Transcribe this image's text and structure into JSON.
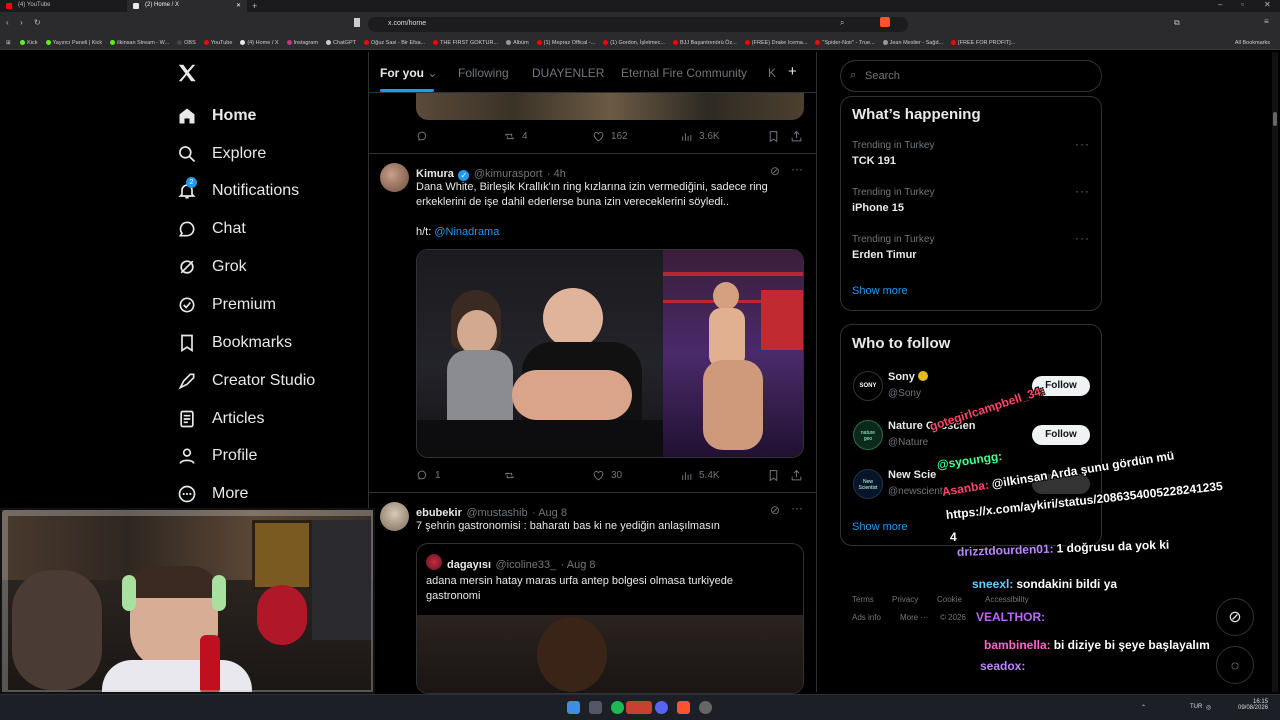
{
  "browser": {
    "tabs": [
      {
        "label": "(4) YouTube",
        "color": "#ff0000"
      },
      {
        "label": "(2) Home / X",
        "color": "#e7e9ea"
      }
    ],
    "url": "x.com/home",
    "bookmarks": [
      {
        "label": "Kick",
        "color": "#53fc18"
      },
      {
        "label": "Yayıncı Paneli | Kick",
        "color": "#53fc18"
      },
      {
        "label": "ilkinsan Stream - W...",
        "color": "#53fc18"
      },
      {
        "label": "OBS",
        "color": "#444444"
      },
      {
        "label": "YouTube",
        "color": "#ff0000"
      },
      {
        "label": "(4) Home / X",
        "color": "#e7e9ea"
      },
      {
        "label": "Instagram",
        "color": "#c13584"
      },
      {
        "label": "ChatGPT",
        "color": "#cccccc"
      },
      {
        "label": "Oğuz Sasi - Bir Efsa...",
        "color": "#ff0000"
      },
      {
        "label": "THE FIRST GOKTUR...",
        "color": "#ff0000"
      },
      {
        "label": "Albüm",
        "color": "#999999"
      },
      {
        "label": "(1) Mepraz Offical -...",
        "color": "#ff0000"
      },
      {
        "label": "(1) Gordon, İşletmec...",
        "color": "#ff0000"
      },
      {
        "label": "BJJ Başantrenörü Öz...",
        "color": "#ff0000"
      },
      {
        "label": "(FREE) Drake Icema...",
        "color": "#ff0000"
      },
      {
        "label": "\"Spider-Noir\" - True...",
        "color": "#ff0000"
      },
      {
        "label": "Jean Meslier - Sağd...",
        "color": "#999999"
      },
      {
        "label": "[FREE FOR PROFIT]...",
        "color": "#ff0000"
      }
    ],
    "all_bookmarks": "All Bookmarks"
  },
  "nav": {
    "items": [
      {
        "label": "Home",
        "icon": "home-icon"
      },
      {
        "label": "Explore",
        "icon": "search-icon"
      },
      {
        "label": "Notifications",
        "icon": "bell-icon",
        "badge": "2"
      },
      {
        "label": "Chat",
        "icon": "chat-icon"
      },
      {
        "label": "Grok",
        "icon": "grok-icon"
      },
      {
        "label": "Premium",
        "icon": "premium-icon"
      },
      {
        "label": "Bookmarks",
        "icon": "bookmark-icon"
      },
      {
        "label": "Creator Studio",
        "icon": "rocket-icon"
      },
      {
        "label": "Articles",
        "icon": "article-icon"
      },
      {
        "label": "Profile",
        "icon": "profile-icon"
      },
      {
        "label": "More",
        "icon": "more-icon"
      }
    ]
  },
  "feed": {
    "tabs": [
      "For you",
      "Following",
      "DUAYENLER",
      "Eternal Fire Community",
      "K"
    ],
    "prev_post": {
      "replies": "",
      "reposts": "4",
      "likes": "162",
      "views": "3.6K"
    },
    "post1": {
      "name": "Kimura",
      "handle": "@kimurasport",
      "time": "· 4h",
      "text_line1": "Dana White, Birleşik Krallık'ın ring kızlarına izin vermediğini, sadece ring",
      "text_line2": "erkeklerini de  işe dahil ederlerse buna izin vereceklerini söyledi..",
      "ht_label": "h/t: ",
      "ht_mention": "@Ninadrama",
      "replies": "1",
      "reposts": "",
      "likes": "30",
      "views": "5.4K"
    },
    "post2": {
      "name": "ebubekir",
      "handle": "@mustashib",
      "time": "· Aug 8",
      "text": "7 şehrin gastronomisi : baharatı bas ki ne yediğin anlaşılmasın",
      "quote": {
        "name": "dagayısı",
        "handle": "@icoline33_",
        "time": "· Aug 8",
        "text_line1": "adana mersin hatay maras urfa antep bolgesi olmasa turkiyede",
        "text_line2": "gastronomi"
      }
    }
  },
  "sidebar": {
    "search_placeholder": "Search",
    "happening_title": "What’s happening",
    "trends": [
      {
        "sub": "Trending in Turkey",
        "name": "TCK 191"
      },
      {
        "sub": "Trending in Turkey",
        "name": "iPhone 15"
      },
      {
        "sub": "Trending in Turkey",
        "name": "Erden Timur"
      }
    ],
    "show_more": "Show more",
    "who_title": "Who to follow",
    "follow": [
      {
        "name": "Sony",
        "handle": "@Sony",
        "button": "Follow"
      },
      {
        "name": "Nature Geoscien",
        "handle": "@Nature",
        "button": "Follow"
      },
      {
        "name": "New Scie",
        "handle": "@newscientist",
        "button": ""
      }
    ],
    "footer": [
      "Terms",
      "Privacy",
      "Cookie",
      "Accessibility",
      "Ads info",
      "More ···",
      "© 2026"
    ]
  },
  "chat_overlay": [
    {
      "user": "gotegirlcampbell_34:",
      "msg": "",
      "color": "#ff4466"
    },
    {
      "user": "@syoungg:",
      "msg": "",
      "color": "#44ff88"
    },
    {
      "user": "Asanba:",
      "msg": "@ilkinsan Arda şunu gördün mü",
      "color": "#ff4466"
    },
    {
      "user": "",
      "msg": "https://x.com/aykiri/status/2086354005228241235",
      "color": "#ffffff"
    },
    {
      "user": "",
      "msg": "4",
      "color": "#ffffff"
    },
    {
      "user": "drizztdourden01:",
      "msg": "1 doğrusu da yok ki",
      "color": "#bb88ff"
    },
    {
      "user": "sneexl:",
      "msg": "sondakini bildi ya",
      "color": "#66ccff"
    },
    {
      "user": "VEALTHOR:",
      "msg": "",
      "color": "#bb66ff"
    },
    {
      "user": "bambinella:",
      "msg": "bi diziye bi şeye başlayalım",
      "color": "#ff66cc"
    },
    {
      "user": "seadox:",
      "msg": "",
      "color": "#bb88ff"
    }
  ],
  "taskbar": {
    "lang": "TUR",
    "time": "16:15",
    "date": "09/08/2026"
  }
}
